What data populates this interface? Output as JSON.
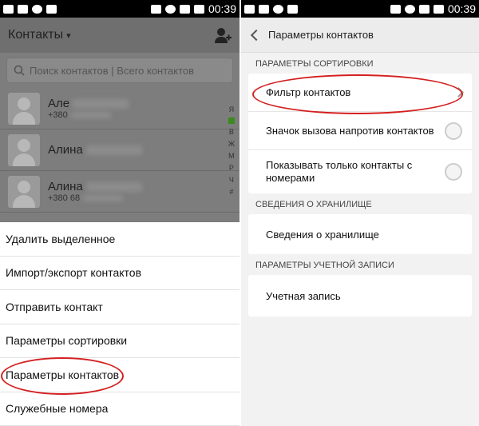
{
  "left": {
    "status": {
      "time": "00:39"
    },
    "header": {
      "title": "Контакты"
    },
    "search": {
      "placeholder": "Поиск контактов | Всего контактов"
    },
    "contacts": [
      {
        "name": "Але",
        "phone": "+380"
      },
      {
        "name": "Алина",
        "phone": ""
      },
      {
        "name": "Алина",
        "phone": "+380 68"
      }
    ],
    "alphabet": [
      "Я",
      "",
      "В",
      "Ж",
      "М",
      "Р",
      "Ч",
      "#"
    ],
    "menu": [
      "Удалить выделенное",
      "Импорт/экспорт контактов",
      "Отправить контакт",
      "Параметры сортировки",
      "Параметры контактов",
      "Служебные номера"
    ]
  },
  "right": {
    "status": {
      "time": "00:39"
    },
    "header": {
      "title": "Параметры контактов"
    },
    "sections": [
      {
        "title": "ПАРАМЕТРЫ СОРТИРОВКИ",
        "items": [
          {
            "label": "Фильтр контактов",
            "control": "chevron"
          },
          {
            "label": "Значок вызова напротив контактов",
            "control": "toggle"
          },
          {
            "label": "Показывать только контакты с номерами",
            "control": "toggle"
          }
        ]
      },
      {
        "title": "СВЕДЕНИЯ О ХРАНИЛИЩЕ",
        "items": [
          {
            "label": "Сведения о хранилище",
            "control": "none"
          }
        ]
      },
      {
        "title": "ПАРАМЕТРЫ УЧЕТНОЙ ЗАПИСИ",
        "items": [
          {
            "label": "Учетная запись",
            "control": "none"
          }
        ]
      }
    ]
  },
  "colors": {
    "highlight": "#d42020",
    "accent_green": "#3a8a1e"
  }
}
